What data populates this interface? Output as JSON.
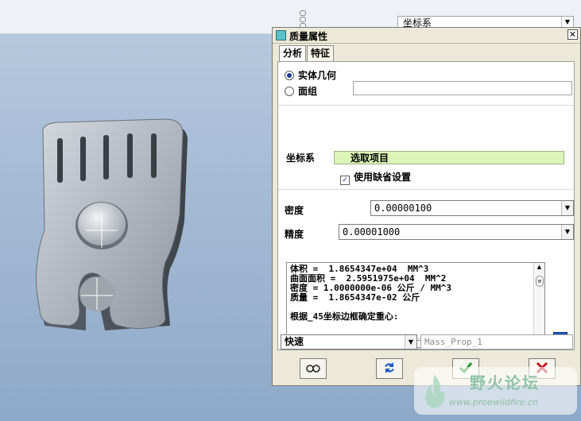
{
  "top": {
    "coord_select_value": "坐标系"
  },
  "dialog": {
    "title": "质量属性",
    "tabs": [
      "分析",
      "特征"
    ],
    "solid_geometry_label": "实体几何",
    "surface_label": "面组",
    "coord_sys_label": "坐标系",
    "select_item": "选取项目",
    "use_default_label": "使用缺省设置",
    "density_label": "密度",
    "density_value": "0.00000100",
    "accuracy_label": "精度",
    "accuracy_value": "0.00001000",
    "results": [
      "体积 =  1.8654347e+04  MM^3",
      "曲面面积 =  2.5951975e+04  MM^2",
      "密度 = 1.0000000e-06 公斤 / MM^3",
      "质量 =  1.8654347e-02 公斤",
      "",
      "根据_45坐标边框确定重心:"
    ],
    "mode_value": "快速",
    "name_value": "Mass_Prop_1"
  },
  "watermark": {
    "text": "野火论坛",
    "url": "www.proewildfire.cn"
  },
  "colors": {
    "dialog_bg": "#ece9d8",
    "select_highlight": "#dcf5b8",
    "ok_green": "#1f9a2a",
    "cancel_red": "#c4161c",
    "info_blue": "#1c58c8"
  }
}
